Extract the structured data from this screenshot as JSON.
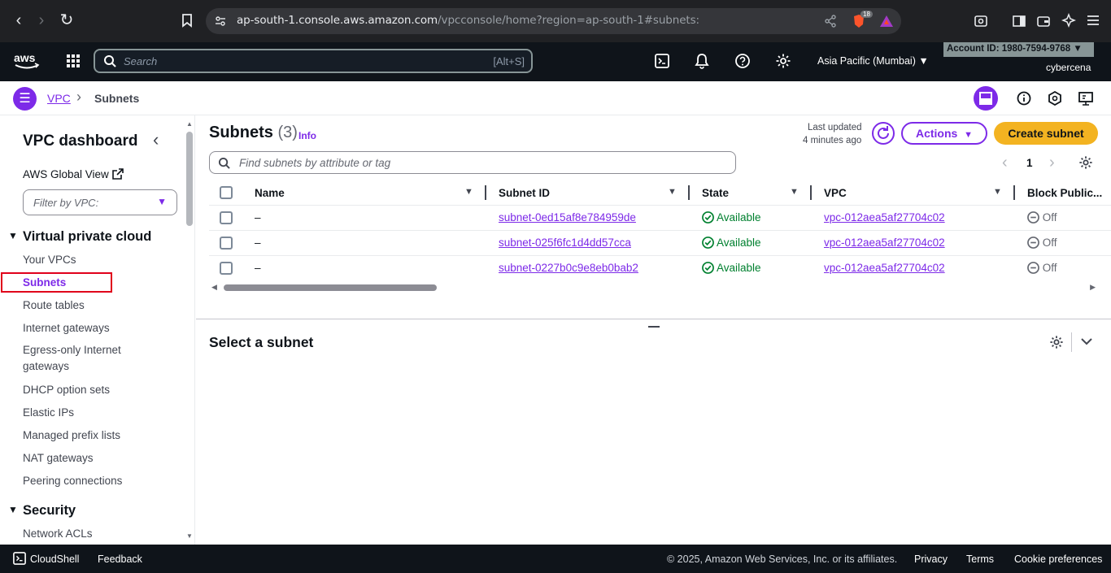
{
  "browser": {
    "url_host": "ap-south-1.console.aws.amazon.com",
    "url_path": "/vpcconsole/home?region=ap-south-1#subnets:",
    "shield_count": "18"
  },
  "topnav": {
    "search_placeholder": "Search",
    "search_shortcut": "[Alt+S]",
    "region": "Asia Pacific (Mumbai)",
    "account": "Account ID: 1980-7594-9768",
    "user": "cybercena"
  },
  "breadcrumb": {
    "root": "VPC",
    "current": "Subnets"
  },
  "sidebar": {
    "title": "VPC dashboard",
    "global_view": "AWS Global View",
    "filter_placeholder": "Filter by VPC:",
    "section_vpc": "Virtual private cloud",
    "items": [
      "Your VPCs",
      "Subnets",
      "Route tables",
      "Internet gateways",
      "Egress-only Internet gateways",
      "DHCP option sets",
      "Elastic IPs",
      "Managed prefix lists",
      "NAT gateways",
      "Peering connections"
    ],
    "section_security": "Security",
    "security_items": [
      "Network ACLs"
    ]
  },
  "main": {
    "title": "Subnets",
    "count": "(3)",
    "info": "Info",
    "last_updated_label": "Last updated",
    "last_updated_value": "4 minutes ago",
    "actions_label": "Actions",
    "create_label": "Create subnet",
    "filter_placeholder": "Find subnets by attribute or tag",
    "page_number": "1",
    "columns": [
      "Name",
      "Subnet ID",
      "State",
      "VPC",
      "Block Public..."
    ],
    "rows": [
      {
        "name": "–",
        "subnet_id": "subnet-0ed15af8e784959de",
        "state": "Available",
        "vpc": "vpc-012aea5af27704c02",
        "block": "Off"
      },
      {
        "name": "–",
        "subnet_id": "subnet-025f6fc1d4dd57cca",
        "state": "Available",
        "vpc": "vpc-012aea5af27704c02",
        "block": "Off"
      },
      {
        "name": "–",
        "subnet_id": "subnet-0227b0c9e8eb0bab2",
        "state": "Available",
        "vpc": "vpc-012aea5af27704c02",
        "block": "Off"
      }
    ],
    "detail_title": "Select a subnet"
  },
  "footer": {
    "cloudshell": "CloudShell",
    "feedback": "Feedback",
    "copyright": "© 2025, Amazon Web Services, Inc. or its affiliates.",
    "privacy": "Privacy",
    "terms": "Terms",
    "cookies": "Cookie preferences"
  },
  "colors": {
    "accent": "#7d2ae8",
    "primary_button": "#f3b321",
    "topnav": "#0f141a",
    "available": "#00802f",
    "selection_highlight": "#e0001b"
  }
}
